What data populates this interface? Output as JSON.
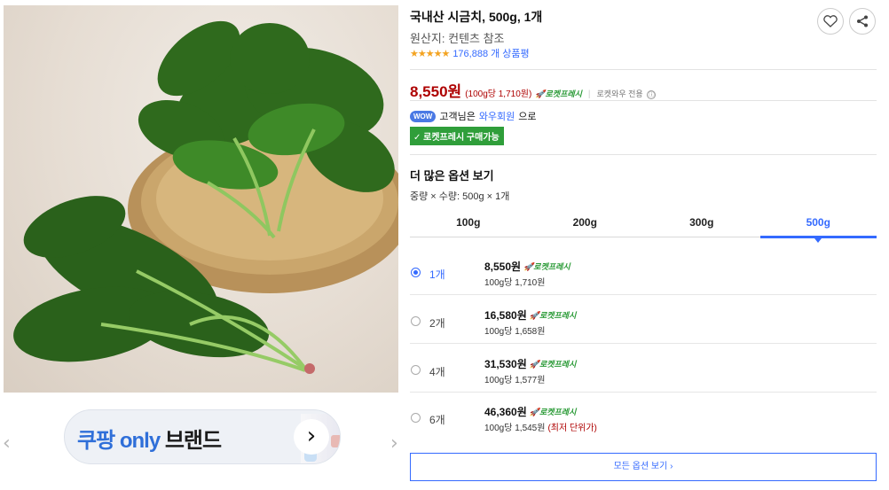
{
  "product": {
    "title": "국내산 시금치, 500g, 1개",
    "origin": "원산지: 컨텐츠 참조",
    "stars": "★★★★★",
    "rating_count": "176,888 개 상품평"
  },
  "price": {
    "main": "8,550원",
    "unit": "(100g당 1,710원)",
    "rocket": "로켓프레시",
    "wow_note": "로켓와우 전용",
    "info_icon": "ⓘ"
  },
  "wow": {
    "badge": "WOW",
    "prefix": "고객님은",
    "link": "와우회원",
    "suffix": "으로"
  },
  "rocket_purchase": "✓ 로켓프레시 구매가능",
  "options": {
    "title": "더 많은 옵션 보기",
    "selected": "중량 × 수량: 500g × 1개",
    "tabs": [
      "100g",
      "200g",
      "300g",
      "500g"
    ],
    "rows": [
      {
        "qty": "1개",
        "price": "8,550원",
        "rocket": "로켓프레시",
        "unit": "100g당 1,710원",
        "note": ""
      },
      {
        "qty": "2개",
        "price": "16,580원",
        "rocket": "로켓프레시",
        "unit": "100g당 1,658원",
        "note": ""
      },
      {
        "qty": "4개",
        "price": "31,530원",
        "rocket": "로켓프레시",
        "unit": "100g당 1,577원",
        "note": ""
      },
      {
        "qty": "6개",
        "price": "46,360원",
        "rocket": "로켓프레시",
        "unit": "100g당 1,545원",
        "note": "(최저 단위가)"
      }
    ],
    "all_button": "모든 옵션 보기 ›"
  },
  "banner": {
    "brand_a": "쿠팡 only",
    "brand_b": "브랜드",
    "chevron": "›"
  },
  "nav": {
    "prev": "‹",
    "next": "›"
  },
  "colors": {
    "price_red": "#ae0000",
    "accent_blue": "#346aff",
    "rocket_green": "#2f9e3a",
    "star_orange": "#f3a321"
  }
}
